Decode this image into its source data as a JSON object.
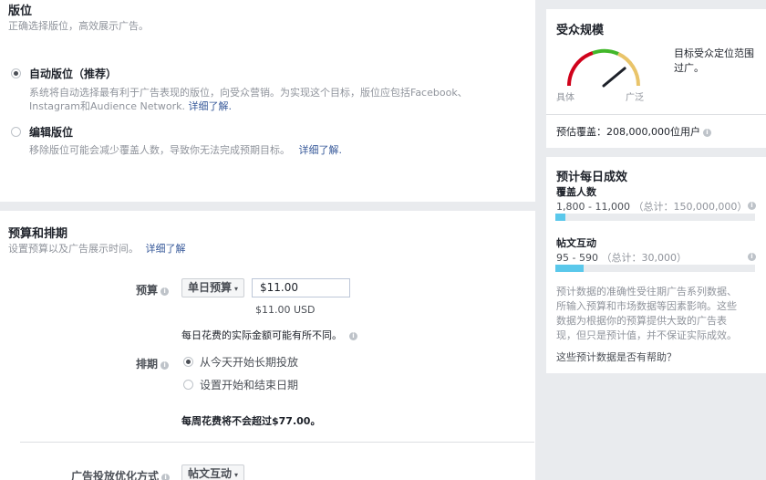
{
  "placement": {
    "title": "版位",
    "subtitle": "正确选择版位，高效展示广告。",
    "auto": {
      "label": "自动版位（推荐）",
      "desc_line1": "系统将自动选择最有利于广告表现的版位，向受众营销。为实现这个目标，版位应包括Facebook、",
      "desc_line2": "Instagram和Audience Network.",
      "learn_more": "详细了解."
    },
    "edit": {
      "label": "编辑版位",
      "desc": "移除版位可能会减少覆盖人数，导致你无法完成预期目标。",
      "learn_more": "详细了解."
    }
  },
  "budget": {
    "title": "预算和排期",
    "subtitle": "设置预算以及广告展示时间。",
    "learn_more": "详细了解",
    "budget_label": "预算",
    "budget_type": "单日预算",
    "budget_value": "$11.00",
    "budget_usd": "$11.00 USD",
    "daily_note": "每日花费的实际金额可能有所不同。",
    "schedule_label": "排期",
    "schedule_option1": "从今天开始长期投放",
    "schedule_option2": "设置开始和结束日期",
    "weekly_note": "每周花费将不会超过$77.00。",
    "optimization_label": "广告投放优化方式",
    "optimization_value": "帖文互动"
  },
  "audience": {
    "title": "受众规模",
    "gauge_left": "具体",
    "gauge_right": "广泛",
    "gauge_level": 0.78,
    "note": "目标受众定位范围过广。",
    "reach_label": "预估覆盖：208,000,000位用户"
  },
  "results": {
    "title": "预计每日成效",
    "reach": {
      "label": "覆盖人数",
      "range": "1,800 - 11,000",
      "total": "（总计：150,000,000）",
      "fraction": 0.05
    },
    "engagement": {
      "label": "帖文互动",
      "range": "95 - 590",
      "total": "（总计：30,000）",
      "fraction": 0.14
    },
    "disclaimer_l1": "预计数据的准确性受往期广告系列数据、",
    "disclaimer_l2": "所输入预算和市场数据等因素影响。这些",
    "disclaimer_l3": "数据为根据你的预算提供大致的广告表",
    "disclaimer_l4": "现，但只是预计值，并不保证实际成效。",
    "helpful_link": "这些预计数据是否有帮助？"
  },
  "colors": {
    "link": "#365899",
    "bar_fill": "#5ac8eb",
    "gauge_red": "#d0021b",
    "gauge_green": "#42b72a",
    "gauge_yellow": "#e9c46a"
  },
  "icons": [
    "info-icon",
    "radio-selected",
    "radio-unselected",
    "dropdown-arrow-icon",
    "gauge-needle-icon"
  ]
}
